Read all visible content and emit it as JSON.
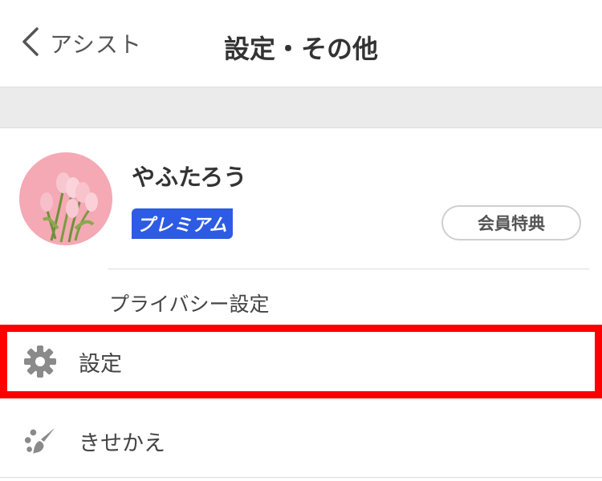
{
  "header": {
    "back_label": "アシスト",
    "title": "設定・その他"
  },
  "profile": {
    "username": "やふたろう",
    "premium_badge": "プレミアム",
    "benefits_button": "会員特典"
  },
  "privacy_link": "プライバシー設定",
  "menu": [
    {
      "label": "設定",
      "icon": "gear-icon"
    },
    {
      "label": "きせかえ",
      "icon": "paintbrush-icon"
    }
  ],
  "colors": {
    "premium_blue": "#2d5be3",
    "highlight_red": "#ff0000",
    "icon_gray": "#8a8a8a"
  }
}
